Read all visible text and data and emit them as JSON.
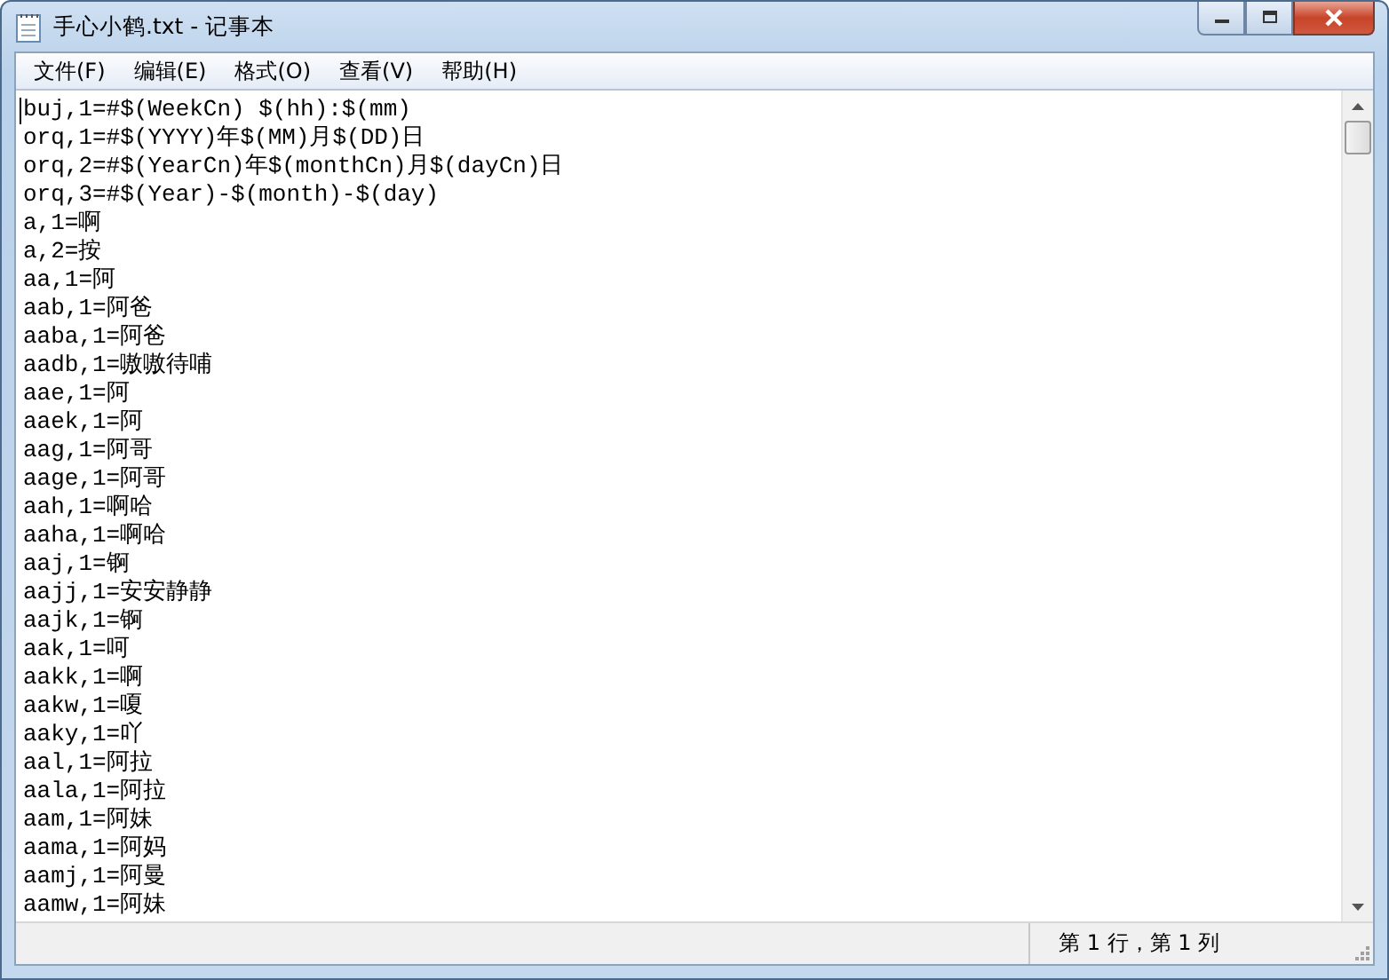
{
  "window": {
    "title": "手心小鹤.txt - 记事本"
  },
  "menu": [
    "文件(F)",
    "编辑(E)",
    "格式(O)",
    "查看(V)",
    "帮助(H)"
  ],
  "editor": {
    "lines": [
      "buj,1=#$(WeekCn) $(hh):$(mm)",
      "orq,1=#$(YYYY)年$(MM)月$(DD)日",
      "orq,2=#$(YearCn)年$(monthCn)月$(dayCn)日",
      "orq,3=#$(Year)-$(month)-$(day)",
      "a,1=啊",
      "a,2=按",
      "aa,1=阿",
      "aab,1=阿爸",
      "aaba,1=阿爸",
      "aadb,1=嗷嗷待哺",
      "aae,1=阿",
      "aaek,1=阿",
      "aag,1=阿哥",
      "aage,1=阿哥",
      "aah,1=啊哈",
      "aaha,1=啊哈",
      "aaj,1=锕",
      "aajj,1=安安静静",
      "aajk,1=锕",
      "aak,1=呵",
      "aakk,1=啊",
      "aakw,1=嗄",
      "aaky,1=吖",
      "aal,1=阿拉",
      "aala,1=阿拉",
      "aam,1=阿妹",
      "aama,1=阿妈",
      "aamj,1=阿曼",
      "aamw,1=阿妹"
    ]
  },
  "status_bar": {
    "position": "第 1 行，第 1 列"
  }
}
